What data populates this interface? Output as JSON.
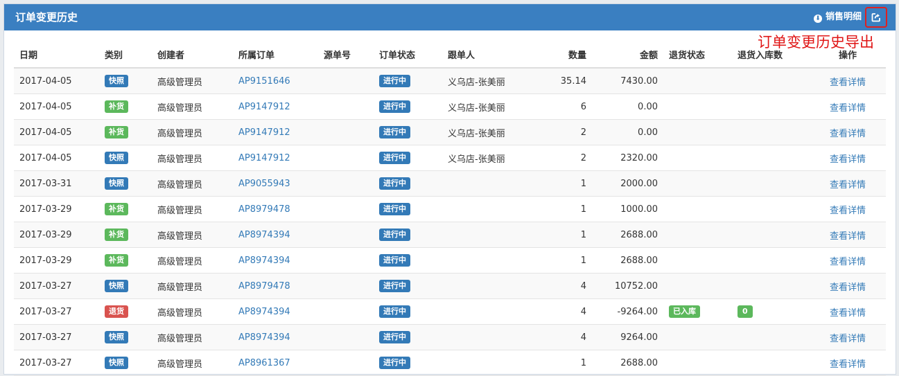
{
  "panel": {
    "title": "订单变更历史",
    "sales_link": "销售明细",
    "export_annotation": "订单变更历史导出"
  },
  "table": {
    "headers": [
      "日期",
      "类别",
      "创建者",
      "所属订单",
      "源单号",
      "订单状态",
      "跟单人",
      "数量",
      "金额",
      "退货状态",
      "退货入库数",
      "操作"
    ],
    "rows": [
      {
        "date": "2017-04-05",
        "type": "快照",
        "type_style": "primary",
        "creator": "高级管理员",
        "order": "AP9151646",
        "source": "",
        "status": "进行中",
        "follower": "义乌店-张美丽",
        "qty": "35.14",
        "amount": "7430.00",
        "return_status": "",
        "return_qty": "",
        "action": "查看详情"
      },
      {
        "date": "2017-04-05",
        "type": "补货",
        "type_style": "success",
        "creator": "高级管理员",
        "order": "AP9147912",
        "source": "",
        "status": "进行中",
        "follower": "义乌店-张美丽",
        "qty": "6",
        "amount": "0.00",
        "return_status": "",
        "return_qty": "",
        "action": "查看详情"
      },
      {
        "date": "2017-04-05",
        "type": "补货",
        "type_style": "success",
        "creator": "高级管理员",
        "order": "AP9147912",
        "source": "",
        "status": "进行中",
        "follower": "义乌店-张美丽",
        "qty": "2",
        "amount": "0.00",
        "return_status": "",
        "return_qty": "",
        "action": "查看详情"
      },
      {
        "date": "2017-04-05",
        "type": "快照",
        "type_style": "primary",
        "creator": "高级管理员",
        "order": "AP9147912",
        "source": "",
        "status": "进行中",
        "follower": "义乌店-张美丽",
        "qty": "2",
        "amount": "2320.00",
        "return_status": "",
        "return_qty": "",
        "action": "查看详情"
      },
      {
        "date": "2017-03-31",
        "type": "快照",
        "type_style": "primary",
        "creator": "高级管理员",
        "order": "AP9055943",
        "source": "",
        "status": "进行中",
        "follower": "",
        "qty": "1",
        "amount": "2000.00",
        "return_status": "",
        "return_qty": "",
        "action": "查看详情"
      },
      {
        "date": "2017-03-29",
        "type": "补货",
        "type_style": "success",
        "creator": "高级管理员",
        "order": "AP8979478",
        "source": "",
        "status": "进行中",
        "follower": "",
        "qty": "1",
        "amount": "1000.00",
        "return_status": "",
        "return_qty": "",
        "action": "查看详情"
      },
      {
        "date": "2017-03-29",
        "type": "补货",
        "type_style": "success",
        "creator": "高级管理员",
        "order": "AP8974394",
        "source": "",
        "status": "进行中",
        "follower": "",
        "qty": "1",
        "amount": "2688.00",
        "return_status": "",
        "return_qty": "",
        "action": "查看详情"
      },
      {
        "date": "2017-03-29",
        "type": "补货",
        "type_style": "success",
        "creator": "高级管理员",
        "order": "AP8974394",
        "source": "",
        "status": "进行中",
        "follower": "",
        "qty": "1",
        "amount": "2688.00",
        "return_status": "",
        "return_qty": "",
        "action": "查看详情"
      },
      {
        "date": "2017-03-27",
        "type": "快照",
        "type_style": "primary",
        "creator": "高级管理员",
        "order": "AP8979478",
        "source": "",
        "status": "进行中",
        "follower": "",
        "qty": "4",
        "amount": "10752.00",
        "return_status": "",
        "return_qty": "",
        "action": "查看详情"
      },
      {
        "date": "2017-03-27",
        "type": "退货",
        "type_style": "danger",
        "creator": "高级管理员",
        "order": "AP8974394",
        "source": "",
        "status": "进行中",
        "follower": "",
        "qty": "4",
        "amount": "-9264.00",
        "return_status": "已入库",
        "return_qty": "0",
        "action": "查看详情"
      },
      {
        "date": "2017-03-27",
        "type": "快照",
        "type_style": "primary",
        "creator": "高级管理员",
        "order": "AP8974394",
        "source": "",
        "status": "进行中",
        "follower": "",
        "qty": "4",
        "amount": "9264.00",
        "return_status": "",
        "return_qty": "",
        "action": "查看详情"
      },
      {
        "date": "2017-03-27",
        "type": "快照",
        "type_style": "primary",
        "creator": "高级管理员",
        "order": "AP8961367",
        "source": "",
        "status": "进行中",
        "follower": "",
        "qty": "1",
        "amount": "2688.00",
        "return_status": "",
        "return_qty": "",
        "action": "查看详情"
      }
    ]
  },
  "icons": {
    "download": "download-circle-icon",
    "export": "share-export-icon"
  },
  "colors": {
    "header_bg": "#3a7fc1",
    "label_primary": "#337ab7",
    "label_success": "#5cb85c",
    "label_danger": "#d9534f",
    "link": "#337ab7",
    "annotation": "#e01515"
  }
}
